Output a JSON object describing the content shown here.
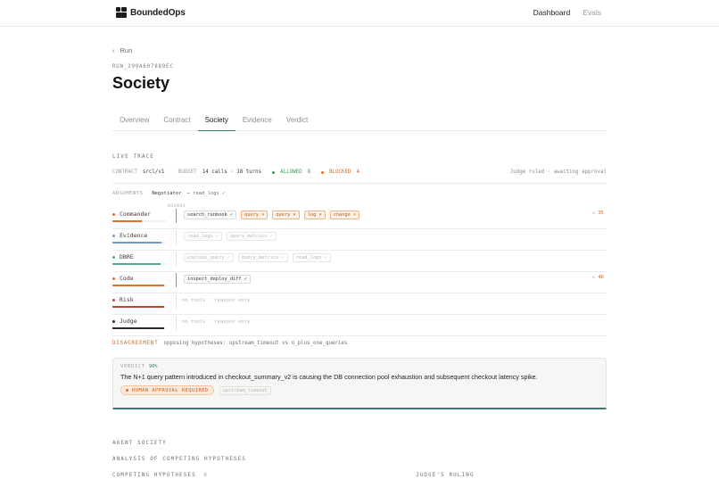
{
  "app": {
    "name": "BoundedOps"
  },
  "nav": {
    "dashboard": "Dashboard",
    "evals": "Evals"
  },
  "header": {
    "back_label": "Run",
    "run_id": "RUN_299A607889EC",
    "title": "Society"
  },
  "tabs": [
    {
      "label": "Overview"
    },
    {
      "label": "Contract"
    },
    {
      "label": "Society"
    },
    {
      "label": "Evidence"
    },
    {
      "label": "Verdict"
    }
  ],
  "live_trace": {
    "label": "LIVE TRACE",
    "contract_label": "CONTRACT",
    "contract_value": "srcl/v1",
    "budget_label": "BUDGET",
    "budget_value": "14 calls · 18 turns",
    "allowed_label": "ALLOWED",
    "allowed_count": "8",
    "blocked_label": "BLOCKED",
    "blocked_count": "4",
    "status": "Judge ruled · awaiting approval"
  },
  "arguments": {
    "label": "ARGUMENTS",
    "agent": "Negotiator",
    "action": "→ read_logs ✓",
    "bounds_label": "BOUNDS"
  },
  "agents": [
    {
      "name": "Commander",
      "color": "#e2702c",
      "tools": [
        {
          "label": "search_runbook ✓",
          "kind": "normal"
        },
        {
          "label": "query ×",
          "kind": "blocked"
        },
        {
          "label": "query ×",
          "kind": "blocked"
        },
        {
          "label": "log ×",
          "kind": "blocked"
        },
        {
          "label": "change ×",
          "kind": "blocked"
        }
      ],
      "alert": "⚠ 35",
      "bar": 0.55
    },
    {
      "name": "Evidence",
      "color": "#6e98cf",
      "tools": [
        {
          "label": "read_logs ✓",
          "kind": "muted"
        },
        {
          "label": "query_metrics ✓",
          "kind": "muted"
        }
      ],
      "alert": "",
      "bar": 0.92
    },
    {
      "name": "DBRE",
      "color": "#52a88a",
      "tools": [
        {
          "label": "explain_query ✓",
          "kind": "muted"
        },
        {
          "label": "query_metrics ✓",
          "kind": "muted"
        },
        {
          "label": "read_logs ✓",
          "kind": "muted"
        }
      ],
      "alert": "",
      "bar": 0.9
    },
    {
      "name": "Code",
      "color": "#e2702c",
      "tools": [
        {
          "label": "inspect_deploy_diff ✓",
          "kind": "normal"
        }
      ],
      "alert": "⚠ 46",
      "bar": 0.97
    },
    {
      "name": "Risk",
      "color": "#b8473a",
      "tools": [],
      "no_tools": "no tools · reasons only",
      "alert": "",
      "bar": 0.97
    },
    {
      "name": "Judge",
      "color": "#2b2b2b",
      "tools": [],
      "no_tools": "no tools · reasons only",
      "alert": "",
      "bar": 0.97
    }
  ],
  "disagreement": {
    "label": "DISAGREEMENT",
    "text": "opposing hypotheses: upstream_timeout vs n_plus_one_queries"
  },
  "verdict": {
    "label": "VERDICT",
    "confidence": "90%",
    "text": "The N+1 query pattern introduced in checkout_summary_v2 is causing the DB connection pool exhaustion and subsequent checkout latency spike.",
    "approval_badge": "HUMAN APPROVAL REQUIRED",
    "alt_badge": "upstream_timeout"
  },
  "bottom": {
    "agent_society": "AGENT SOCIETY",
    "analysis": "ANALYSIS OF COMPETING HYPOTHESES",
    "competing": "COMPETING HYPOTHESES",
    "competing_count": "6",
    "judges_ruling": "JUDGE'S RULING"
  },
  "colors": {
    "accent": "#3f7a73",
    "warning": "#e2702c",
    "allowed": "#3f9a58"
  }
}
